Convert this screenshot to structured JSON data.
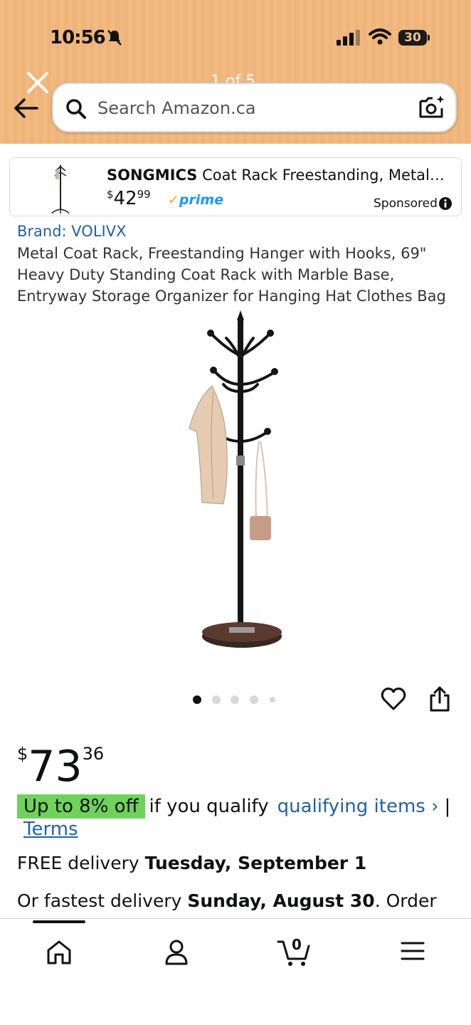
{
  "status_bar": {
    "time": "10:56",
    "battery": "30"
  },
  "header": {
    "page_indicator": "1 of 5",
    "search": {
      "placeholder": "Search Amazon.ca"
    }
  },
  "sponsored": {
    "brand": "SONGMICS",
    "title": "Coat Rack Freestanding, Metal ...",
    "price_symbol": "$",
    "price_whole": "42",
    "price_fraction": "99",
    "prime": "prime",
    "label": "Sponsored"
  },
  "product": {
    "brand_link": "Brand: VOLIVX",
    "title": "Metal Coat Rack, Freestanding Hanger with Hooks, 69\" Heavy Duty Standing Coat Rack with Marble Base, Entryway Storage Organizer for Hanging Hat Clothes Bag",
    "image_count": 5,
    "active_image": 1,
    "price_symbol": "$",
    "price_whole": "73",
    "price_fraction": "36",
    "offer_badge": "Up to 8% off",
    "offer_text": "if you qualify",
    "qualifying_link": "qualifying items ›",
    "separator": "|",
    "terms_link": "Terms",
    "delivery_prefix": "FREE delivery",
    "delivery_date": "Tuesday, September 1",
    "fastest_prefix": "Or fastest delivery",
    "fastest_date": "Sunday, August 30",
    "fastest_suffix": ". Order"
  },
  "bottom_nav": {
    "items": [
      "home-icon",
      "account-icon",
      "cart-icon",
      "menu-icon"
    ],
    "cart_count": "0"
  },
  "colors": {
    "header_bg": "#f2b980",
    "link": "#2162a1",
    "offer_badge": "#6fd35b",
    "prime_blue": "#1a98ff"
  }
}
